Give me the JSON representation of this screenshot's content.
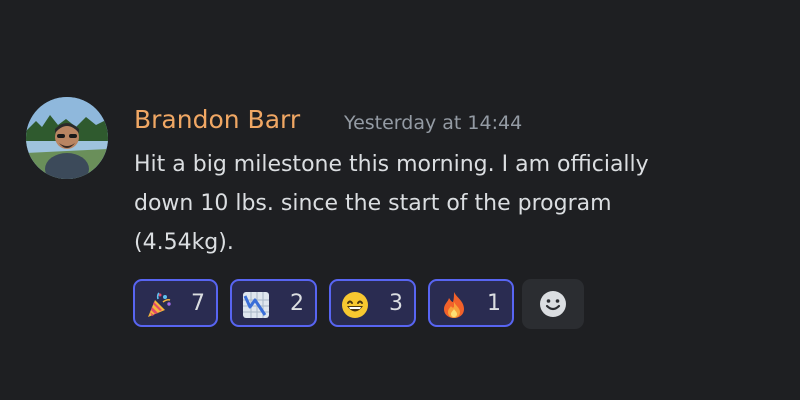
{
  "message": {
    "author": "Brandon Barr",
    "timestamp": "Yesterday at 14:44",
    "author_color": "#f0a764",
    "body_lines": [
      "Hit a big milestone this morning.  I am officially",
      "down 10 lbs. since the start of the program",
      "(4.54kg)."
    ]
  },
  "reactions": [
    {
      "icon": "party-popper-icon",
      "count": "7"
    },
    {
      "icon": "chart-decreasing-icon",
      "count": "2"
    },
    {
      "icon": "grinning-face-icon",
      "count": "3"
    },
    {
      "icon": "fire-icon",
      "count": "1"
    }
  ],
  "add_reaction": {
    "icon": "add-reaction-icon"
  },
  "colors": {
    "background": "#1e1f22",
    "reaction_border": "#5865f2",
    "reaction_bg": "#2a2c51",
    "text": "#dbdee1",
    "muted": "#949ba4"
  }
}
